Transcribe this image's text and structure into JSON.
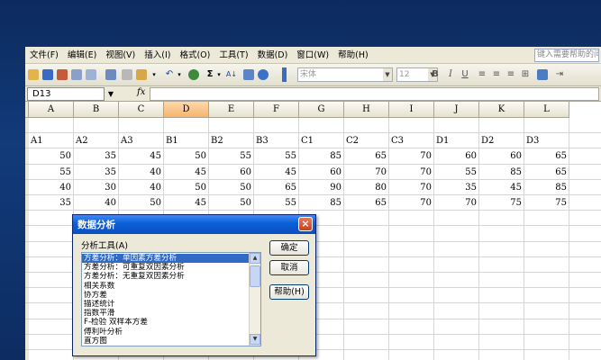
{
  "menu": [
    "文件(F)",
    "编辑(E)",
    "视图(V)",
    "插入(I)",
    "格式(O)",
    "工具(T)",
    "数据(D)",
    "窗口(W)",
    "帮助(H)"
  ],
  "help_box": "键入需要帮助的问题",
  "toolbar": {
    "font_name": "宋体",
    "font_size": "12",
    "bold": "B",
    "italic": "I",
    "underline": "U",
    "sigma": "Σ"
  },
  "formula_bar": {
    "name_box": "D13",
    "fx": "fx",
    "formula": ""
  },
  "columns": [
    "A",
    "B",
    "C",
    "D",
    "E",
    "F",
    "G",
    "H",
    "I",
    "J",
    "K",
    "L"
  ],
  "active_column": "D",
  "headers": [
    "A1",
    "A2",
    "A3",
    "B1",
    "B2",
    "B3",
    "C1",
    "C2",
    "C3",
    "D1",
    "D2",
    "D3"
  ],
  "rows": [
    [
      "50",
      "35",
      "45",
      "50",
      "55",
      "55",
      "85",
      "65",
      "70",
      "60",
      "60",
      "65"
    ],
    [
      "55",
      "35",
      "40",
      "45",
      "60",
      "45",
      "60",
      "70",
      "70",
      "55",
      "85",
      "65"
    ],
    [
      "40",
      "30",
      "40",
      "50",
      "50",
      "65",
      "90",
      "80",
      "70",
      "35",
      "45",
      "85"
    ],
    [
      "35",
      "40",
      "50",
      "45",
      "50",
      "55",
      "85",
      "65",
      "70",
      "70",
      "75",
      "75"
    ]
  ],
  "dialog": {
    "title": "数据分析",
    "close": "×",
    "tool_label": "分析工具(A)",
    "tools": [
      "方差分析：单因素方差分析",
      "方差分析：可重复双因素分析",
      "方差分析：无重复双因素分析",
      "相关系数",
      "协方差",
      "描述统计",
      "指数平滑",
      "F-检验 双样本方差",
      "傅利叶分析",
      "直方图"
    ],
    "selected_index": 0,
    "buttons": {
      "ok": "确定",
      "cancel": "取消",
      "help": "帮助(H)"
    }
  }
}
